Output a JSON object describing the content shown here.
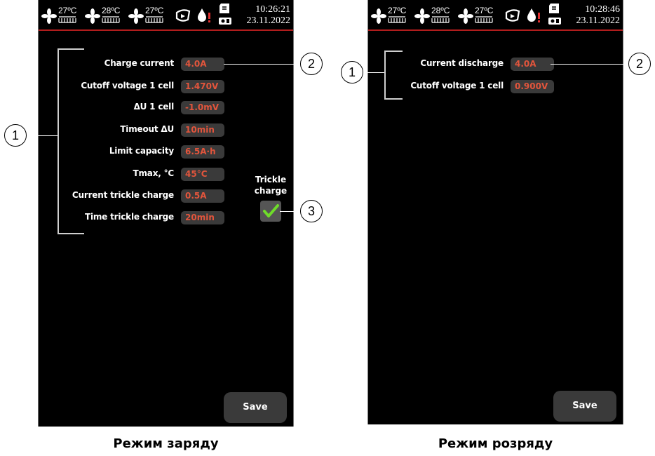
{
  "charge_screen": {
    "status": {
      "temps": [
        "27ºC",
        "28ºC",
        "27ºC"
      ],
      "time": "10:26:21",
      "date": "23.11.2022"
    },
    "params": [
      {
        "label": "Charge current",
        "value": "4.0A"
      },
      {
        "label": "Cutoff voltage 1 cell",
        "value": "1.470V"
      },
      {
        "label": "ΔU 1 cell",
        "value": "-1.0mV"
      },
      {
        "label": "Timeout ΔU",
        "value": "10min"
      },
      {
        "label": "Limit capacity",
        "value": "6.5A·h"
      },
      {
        "label": "Tmax, °C",
        "value": "45°C"
      },
      {
        "label": "Current trickle charge",
        "value": "0.5A"
      },
      {
        "label": "Time trickle charge",
        "value": "20min"
      }
    ],
    "trickle": {
      "line1": "Trickle",
      "line2": "charge",
      "checked": true
    },
    "save_label": "Save",
    "callouts": [
      "1",
      "2",
      "3"
    ]
  },
  "discharge_screen": {
    "status": {
      "temps": [
        "27ºC",
        "28ºC",
        "27ºC"
      ],
      "time": "10:28:46",
      "date": "23.11.2022"
    },
    "params": [
      {
        "label": "Current discharge",
        "value": "4.0A"
      },
      {
        "label": "Cutoff voltage 1 cell",
        "value": "0.900V"
      }
    ],
    "save_label": "Save",
    "callouts": [
      "1",
      "2"
    ]
  },
  "captions": {
    "charge": "Режим заряду",
    "discharge": "Режим розряду"
  },
  "colors": {
    "value_text": "#e2553c",
    "field_bg": "#3a3a3a",
    "status_line": "#b11d1d",
    "check": "#6fdc2a"
  },
  "icons": [
    "fan-icon",
    "fan-comb-icon",
    "chip-icon",
    "drop-alert-icon",
    "sd-card-icon",
    "battery-icon",
    "checkmark-icon"
  ]
}
